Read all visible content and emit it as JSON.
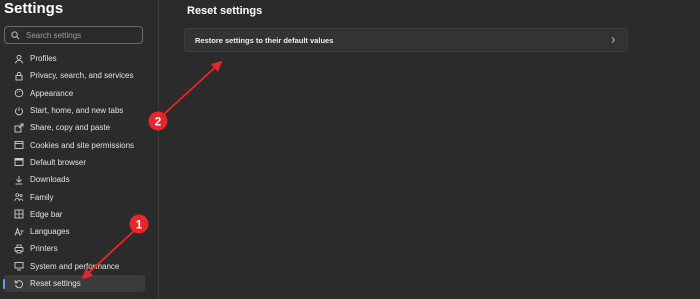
{
  "app": {
    "title": "Settings"
  },
  "search": {
    "placeholder": "Search settings"
  },
  "sidebar": {
    "items": [
      {
        "label": "Profiles",
        "icon": "profile-icon"
      },
      {
        "label": "Privacy, search, and services",
        "icon": "lock-icon"
      },
      {
        "label": "Appearance",
        "icon": "appearance-icon"
      },
      {
        "label": "Start, home, and new tabs",
        "icon": "power-icon"
      },
      {
        "label": "Share, copy and paste",
        "icon": "share-icon"
      },
      {
        "label": "Cookies and site permissions",
        "icon": "cookies-icon"
      },
      {
        "label": "Default browser",
        "icon": "browser-icon"
      },
      {
        "label": "Downloads",
        "icon": "download-icon"
      },
      {
        "label": "Family",
        "icon": "family-icon"
      },
      {
        "label": "Edge bar",
        "icon": "edge-bar-icon"
      },
      {
        "label": "Languages",
        "icon": "languages-icon"
      },
      {
        "label": "Printers",
        "icon": "printer-icon"
      },
      {
        "label": "System and performance",
        "icon": "system-icon"
      },
      {
        "label": "Reset settings",
        "icon": "reset-icon",
        "active": true
      }
    ]
  },
  "main": {
    "title": "Reset settings",
    "restore_label": "Restore settings to their default values"
  },
  "annotations": {
    "badge_1": "1",
    "badge_2": "2",
    "color": "#e8262a"
  },
  "colors": {
    "background": "#2b2b2b",
    "card": "#333333",
    "active_item": "#3b3b3b",
    "accent": "#5aa1e6"
  }
}
